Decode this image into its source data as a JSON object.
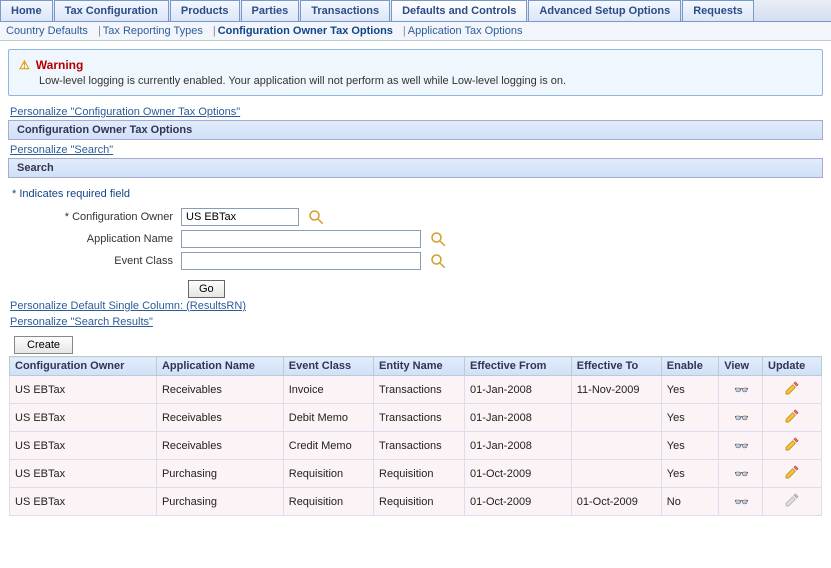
{
  "topTabs": [
    "Home",
    "Tax Configuration",
    "Products",
    "Parties",
    "Transactions",
    "Defaults and Controls",
    "Advanced Setup Options",
    "Requests"
  ],
  "topTabActive": 5,
  "subTabs": [
    "Country Defaults",
    "Tax Reporting Types",
    "Configuration Owner Tax Options",
    "Application Tax Options"
  ],
  "subTabActive": 2,
  "warning": {
    "title": "Warning",
    "body": "Low-level logging is currently enabled. Your application will not perform as well while Low-level logging is on."
  },
  "links": {
    "personalizeCOTO": "Personalize \"Configuration Owner Tax Options\"",
    "personalizeSearch": "Personalize \"Search\"",
    "personalizeResults": "Personalize Default Single Column: (ResultsRN)",
    "personalizeSearchResults": "Personalize \"Search Results\""
  },
  "panel": {
    "title": "Configuration Owner Tax Options",
    "searchTitle": "Search"
  },
  "requiredNote": "*  Indicates required field",
  "form": {
    "configOwnerLabel": "* Configuration Owner",
    "configOwnerValue": "US EBTax",
    "appNameLabel": "Application Name",
    "appNameValue": "",
    "eventClassLabel": "Event Class",
    "eventClassValue": "",
    "goLabel": "Go",
    "createLabel": "Create"
  },
  "columns": [
    "Configuration Owner",
    "Application Name",
    "Event Class",
    "Entity Name",
    "Effective From",
    "Effective To",
    "Enable",
    "View",
    "Update"
  ],
  "rows": [
    {
      "owner": "US EBTax",
      "app": "Receivables",
      "event": "Invoice",
      "entity": "Transactions",
      "from": "01-Jan-2008",
      "to": "11-Nov-2009",
      "enable": "Yes",
      "updatable": true
    },
    {
      "owner": "US EBTax",
      "app": "Receivables",
      "event": "Debit Memo",
      "entity": "Transactions",
      "from": "01-Jan-2008",
      "to": "",
      "enable": "Yes",
      "updatable": true
    },
    {
      "owner": "US EBTax",
      "app": "Receivables",
      "event": "Credit Memo",
      "entity": "Transactions",
      "from": "01-Jan-2008",
      "to": "",
      "enable": "Yes",
      "updatable": true
    },
    {
      "owner": "US EBTax",
      "app": "Purchasing",
      "event": "Requisition",
      "entity": "Requisition",
      "from": "01-Oct-2009",
      "to": "",
      "enable": "Yes",
      "updatable": true
    },
    {
      "owner": "US EBTax",
      "app": "Purchasing",
      "event": "Requisition",
      "entity": "Requisition",
      "from": "01-Oct-2009",
      "to": "01-Oct-2009",
      "enable": "No",
      "updatable": false
    }
  ]
}
